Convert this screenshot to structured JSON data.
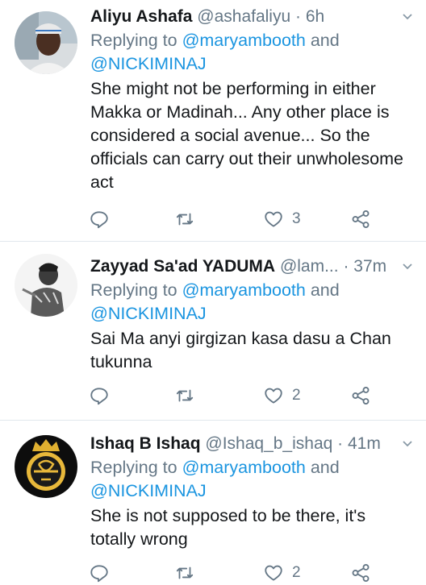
{
  "tweets": [
    {
      "name": "Aliyu Ashafa",
      "handle": "@ashafaliyu",
      "dot": "·",
      "time": "6h",
      "replying_prefix": "Replying to",
      "replying_to_1": "@maryambooth",
      "replying_and": "and",
      "replying_to_2": "@NICKIMINAJ",
      "text": "She might not be performing in either Makka or Madinah... Any other place is considered a social avenue... So the officials can carry out their unwholesome act",
      "likes": "3"
    },
    {
      "name": "Zayyad Sa'ad YADUMA",
      "handle": "@lam...",
      "dot": "·",
      "time": "37m",
      "replying_prefix": "Replying to",
      "replying_to_1": "@maryambooth",
      "replying_and": "and",
      "replying_to_2": "@NICKIMINAJ",
      "text": "Sai Ma anyi girgizan kasa dasu a Chan tukunna",
      "likes": "2"
    },
    {
      "name": "Ishaq B Ishaq",
      "handle": "@Ishaq_b_ishaq",
      "dot": "·",
      "time": "41m",
      "replying_prefix": "Replying to",
      "replying_to_1": "@maryambooth",
      "replying_and": "and",
      "replying_to_2": "@NICKIMINAJ",
      "text": "She is not supposed to be there,  it's totally wrong",
      "likes": "2"
    }
  ],
  "icons": {
    "reply": "reply-icon",
    "retweet": "retweet-icon",
    "like": "heart-icon",
    "share": "share-icon",
    "more": "chevron-down-icon"
  },
  "colors": {
    "link": "#1b95e0",
    "secondary": "#657786",
    "text": "#14171a",
    "border": "#e1e8ed"
  }
}
